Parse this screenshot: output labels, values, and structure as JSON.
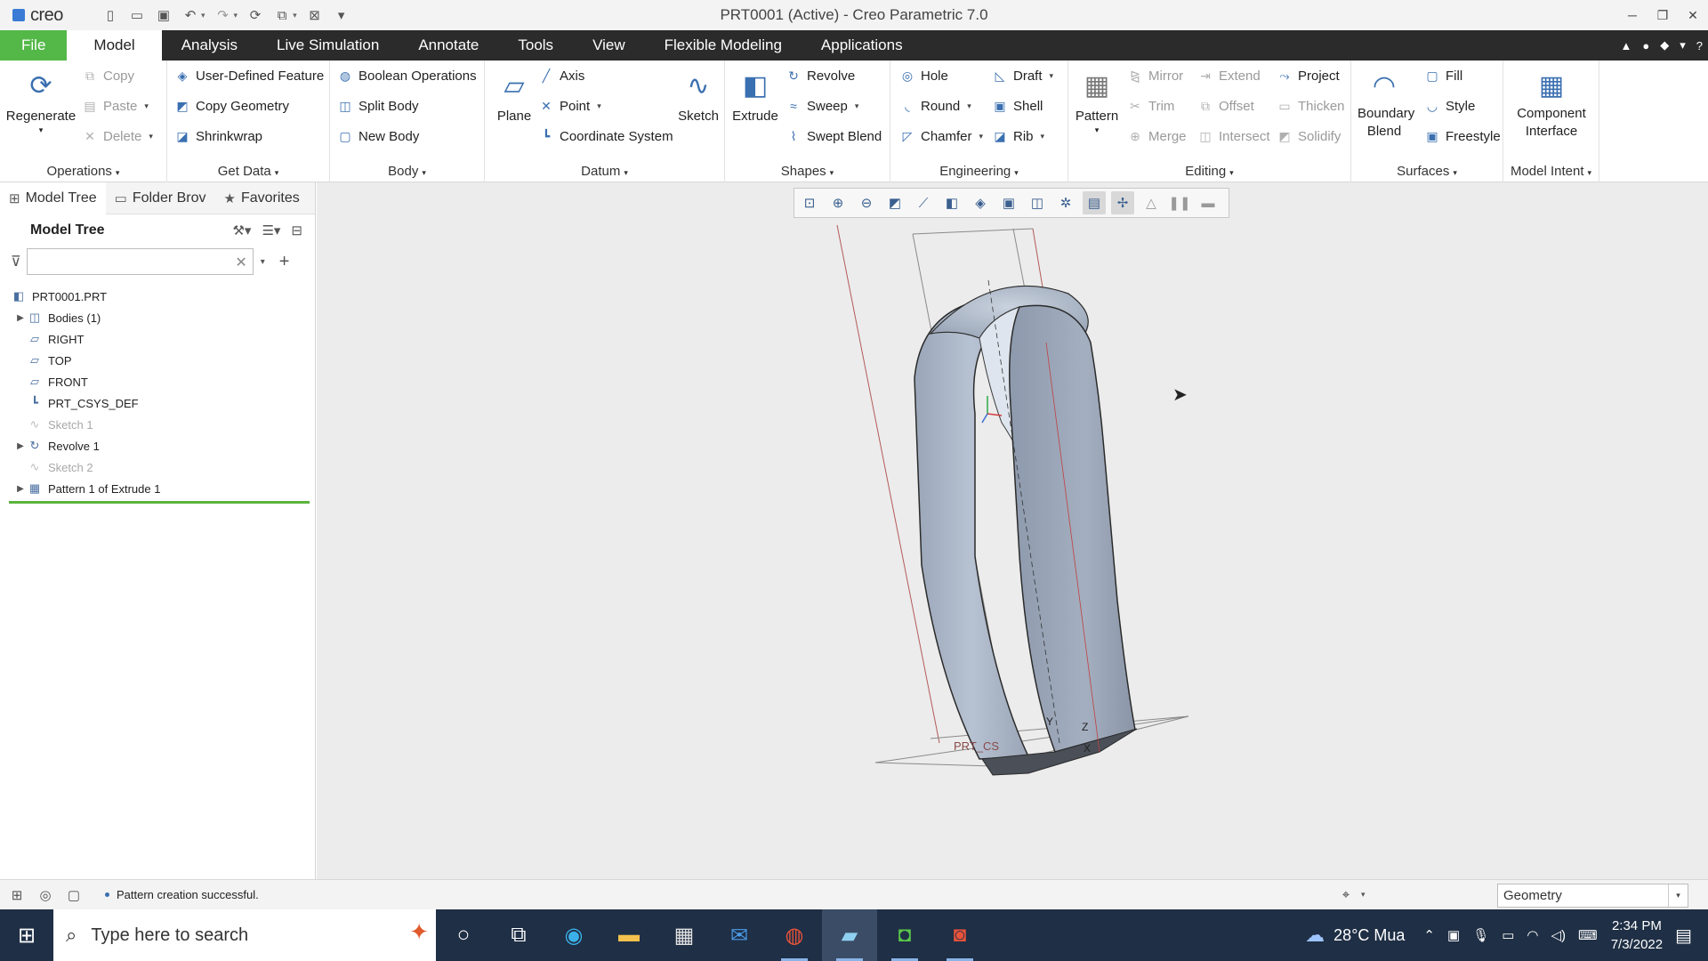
{
  "titlebar": {
    "app_logo": "creo",
    "title": "PRT0001 (Active) - Creo Parametric 7.0",
    "quick_access": [
      "new-icon",
      "open-icon",
      "save-icon",
      "undo-icon",
      "redo-icon",
      "regenerate-icon",
      "windows-icon",
      "close-window-icon",
      "customize-icon"
    ]
  },
  "tabs": [
    "File",
    "Model",
    "Analysis",
    "Live Simulation",
    "Annotate",
    "Tools",
    "View",
    "Flexible Modeling",
    "Applications"
  ],
  "ribbon": {
    "operations": {
      "label": "Operations",
      "regenerate": "Regenerate",
      "copy": "Copy",
      "paste": "Paste",
      "delete": "Delete"
    },
    "get_data": {
      "label": "Get Data",
      "udf": "User-Defined Feature",
      "copy_geometry": "Copy Geometry",
      "shrinkwrap": "Shrinkwrap"
    },
    "body": {
      "label": "Body",
      "boolean": "Boolean Operations",
      "split": "Split Body",
      "new": "New Body"
    },
    "datum": {
      "label": "Datum",
      "plane": "Plane",
      "axis": "Axis",
      "point": "Point",
      "csys": "Coordinate System",
      "sketch": "Sketch"
    },
    "shapes": {
      "label": "Shapes",
      "extrude": "Extrude",
      "revolve": "Revolve",
      "sweep": "Sweep",
      "swept_blend": "Swept Blend"
    },
    "engineering": {
      "label": "Engineering",
      "hole": "Hole",
      "round": "Round",
      "chamfer": "Chamfer",
      "draft": "Draft",
      "shell": "Shell",
      "rib": "Rib"
    },
    "editing": {
      "label": "Editing",
      "pattern": "Pattern",
      "mirror": "Mirror",
      "trim": "Trim",
      "merge": "Merge",
      "extend": "Extend",
      "offset": "Offset",
      "intersect": "Intersect",
      "project": "Project",
      "thicken": "Thicken",
      "solidify": "Solidify"
    },
    "surfaces": {
      "label": "Surfaces",
      "boundary_blend": "Boundary Blend",
      "fill": "Fill",
      "style": "Style",
      "freestyle": "Freestyle"
    },
    "model_intent": {
      "label": "Model Intent",
      "component_interface": "Component Interface"
    }
  },
  "left_panel": {
    "nav_tabs": [
      "Model Tree",
      "Folder Brov",
      "Favorites"
    ],
    "header": "Model Tree",
    "search": {
      "value": "",
      "placeholder": ""
    },
    "tree": [
      {
        "label": "PRT0001.PRT",
        "icon": "part-icon",
        "expandable": false,
        "dim": false
      },
      {
        "label": "Bodies (1)",
        "icon": "bodies-icon",
        "expandable": true,
        "dim": false
      },
      {
        "label": "RIGHT",
        "icon": "datum-plane-icon",
        "expandable": false,
        "dim": false
      },
      {
        "label": "TOP",
        "icon": "datum-plane-icon",
        "expandable": false,
        "dim": false
      },
      {
        "label": "FRONT",
        "icon": "datum-plane-icon",
        "expandable": false,
        "dim": false
      },
      {
        "label": "PRT_CSYS_DEF",
        "icon": "csys-icon",
        "expandable": false,
        "dim": false
      },
      {
        "label": "Sketch 1",
        "icon": "sketch-icon",
        "expandable": false,
        "dim": true
      },
      {
        "label": "Revolve 1",
        "icon": "revolve-icon",
        "expandable": true,
        "dim": false
      },
      {
        "label": "Sketch 2",
        "icon": "sketch-icon",
        "expandable": false,
        "dim": true
      },
      {
        "label": "Pattern 1 of Extrude 1",
        "icon": "pattern-icon",
        "expandable": true,
        "dim": false
      }
    ]
  },
  "viewport": {
    "toolbar": [
      "refit-icon",
      "zoom-in-icon",
      "zoom-out-icon",
      "repaint-icon",
      "perspective-icon",
      "display-style-icon",
      "saved-views-icon",
      "view-manager-icon",
      "section-icon",
      "datum-display-icon",
      "annotation-display-icon",
      "spin-center-icon",
      "tools-icon",
      "pause-icon",
      "close-icon"
    ],
    "model_labels": {
      "csys_name": "PRT_CS",
      "axis_x": "X",
      "axis_y": "Y",
      "axis_z": "Z"
    }
  },
  "statusbar": {
    "message": "Pattern creation successful.",
    "selection_filter": "Geometry"
  },
  "taskbar": {
    "search_placeholder": "Type here to search",
    "weather": "28°C Mua",
    "time": "2:34 PM",
    "date": "7/3/2022"
  },
  "colors": {
    "file_tab": "#54b848",
    "tab_bar": "#2b2b2b",
    "model_fill": "#a9b6c8",
    "taskbar": "#1f2f45"
  }
}
